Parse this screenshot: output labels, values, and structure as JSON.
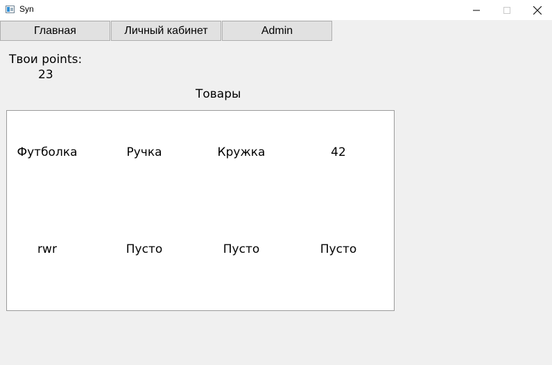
{
  "window": {
    "title": "Syn"
  },
  "nav": {
    "home_label": "Главная",
    "cabinet_label": "Личный кабинет",
    "admin_label": "Admin"
  },
  "points": {
    "label": "Твои points:",
    "value": "23"
  },
  "goods": {
    "title": "Товары",
    "items": [
      "Футболка",
      "Ручка",
      "Кружка",
      "42",
      "rwr",
      "Пусто",
      "Пусто",
      "Пусто"
    ]
  },
  "icons": {
    "app": "app-icon",
    "minimize": "minimize-icon",
    "maximize": "maximize-icon",
    "close": "close-icon"
  }
}
